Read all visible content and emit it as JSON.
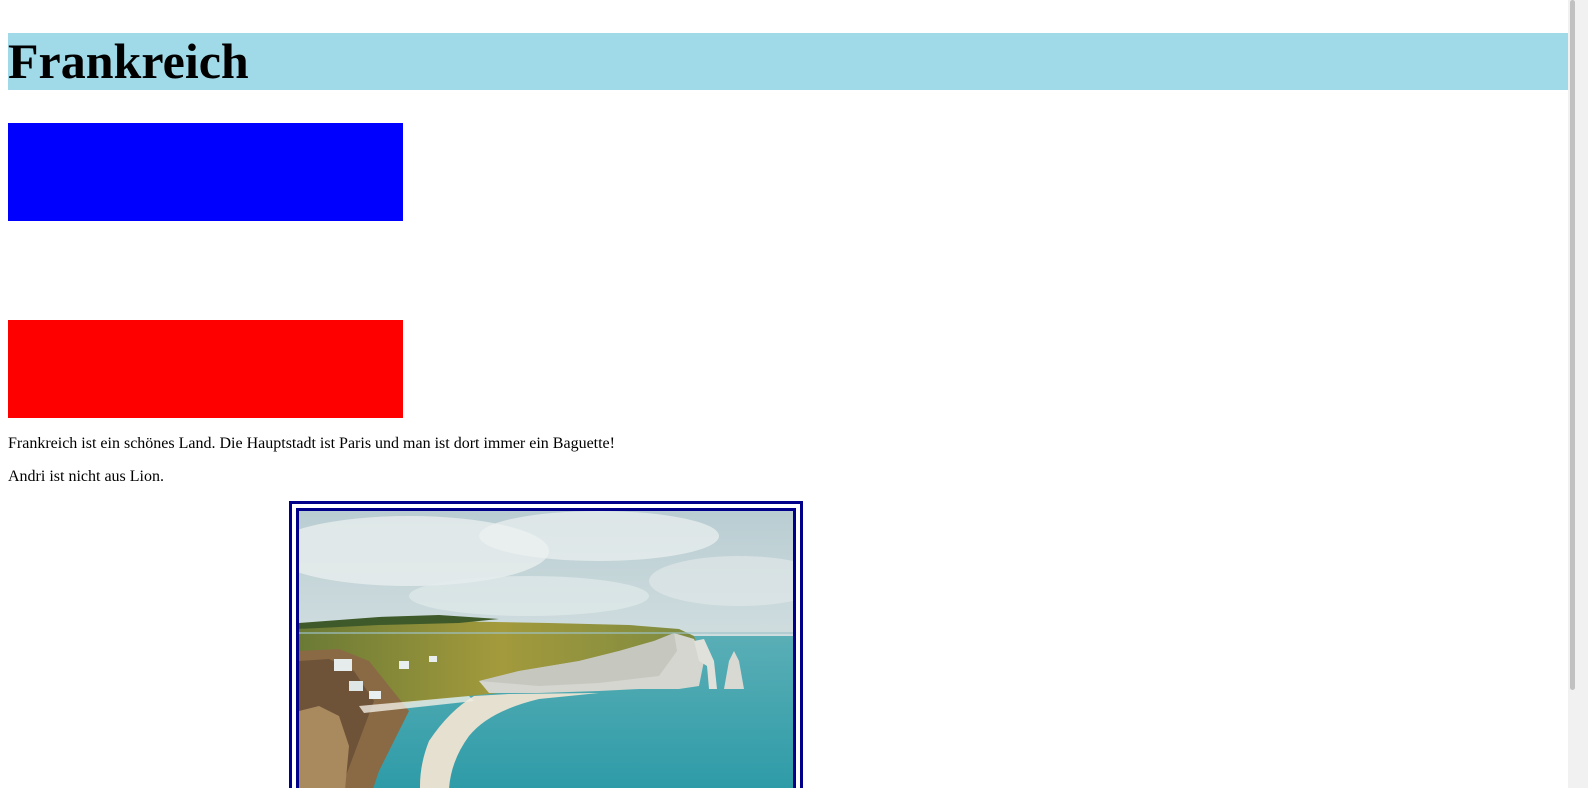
{
  "page": {
    "heading": "Frankreich",
    "heading_bg": "#a0d9e7",
    "flag": {
      "colors": [
        "#0000ff",
        "#ffffff",
        "#ff0000"
      ]
    },
    "paragraphs": [
      "Frankreich ist ein schönes Land. Die Hauptstadt ist Paris und man ist dort immer ein Baguette!",
      "Andri ist nicht aus Lion."
    ],
    "image": {
      "subject": "coastal cliffs with natural arch and beach",
      "border_color": "#00008b"
    }
  }
}
